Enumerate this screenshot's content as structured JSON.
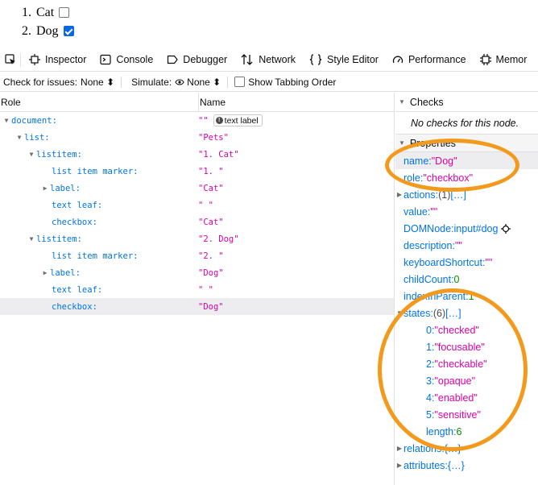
{
  "page": {
    "items": [
      {
        "num": "1.",
        "label": "Cat",
        "checked": false
      },
      {
        "num": "2.",
        "label": "Dog",
        "checked": true
      }
    ]
  },
  "toolbar": {
    "tabs": [
      "Inspector",
      "Console",
      "Debugger",
      "Network",
      "Style Editor",
      "Performance",
      "Memor"
    ]
  },
  "filterbar": {
    "issues_label": "Check for issues:",
    "issues_value": "None ⬍",
    "simulate_label": "Simulate:",
    "simulate_value": "None ⬍",
    "tabbing_label": "Show Tabbing Order"
  },
  "tree": {
    "col_role": "Role",
    "col_name": "Name",
    "badge": "text label",
    "rows": [
      {
        "role": "document:",
        "name": "\"\""
      },
      {
        "role": "list:",
        "name": "\"Pets\""
      },
      {
        "role": "listitem:",
        "name": "\"1. Cat\""
      },
      {
        "role": "list item marker:",
        "name": "\"1. \""
      },
      {
        "role": "label:",
        "name": "\"Cat\""
      },
      {
        "role": "text leaf:",
        "name": "\" \""
      },
      {
        "role": "checkbox:",
        "name": "\"Cat\""
      },
      {
        "role": "listitem:",
        "name": "\"2. Dog\""
      },
      {
        "role": "list item marker:",
        "name": "\"2. \""
      },
      {
        "role": "label:",
        "name": "\"Dog\""
      },
      {
        "role": "text leaf:",
        "name": "\" \""
      },
      {
        "role": "checkbox:",
        "name": "\"Dog\""
      }
    ]
  },
  "sidebar": {
    "checks_title": "Checks",
    "no_checks": "No checks for this node.",
    "properties_title": "Properties",
    "props": {
      "name_k": "name: ",
      "name_v": "\"Dog\"",
      "role_k": "role: ",
      "role_v": "\"checkbox\"",
      "actions_k": "actions: ",
      "actions_v": "(1)",
      "actions_more": "[…]",
      "value_k": "value: ",
      "value_v": "\"\"",
      "domnode_k": "DOMNode: ",
      "domnode_v": "input#dog",
      "description_k": "description: ",
      "description_v": "\"\"",
      "shortcut_k": "keyboardShortcut: ",
      "shortcut_v": "\"\"",
      "childcount_k": "childCount: ",
      "childcount_v": "0",
      "indexinparent_k": "indexInParent: ",
      "indexinparent_v": "1",
      "states_k": "states: ",
      "states_v": "(6)",
      "states_more": "[…]",
      "states": [
        {
          "k": "0: ",
          "v": "\"checked\""
        },
        {
          "k": "1: ",
          "v": "\"focusable\""
        },
        {
          "k": "2: ",
          "v": "\"checkable\""
        },
        {
          "k": "3: ",
          "v": "\"opaque\""
        },
        {
          "k": "4: ",
          "v": "\"enabled\""
        },
        {
          "k": "5: ",
          "v": "\"sensitive\""
        }
      ],
      "length_k": "length: ",
      "length_v": "6",
      "relations_k": "relations: ",
      "relations_v": "{…}",
      "attributes_k": "attributes: ",
      "attributes_v": "{…}"
    }
  },
  "colors": {
    "annotation": "#f39a1d",
    "string": "#dd00a9",
    "key": "#0074e8",
    "number": "#058b00",
    "checkbox_checked": "#0a67e4"
  }
}
